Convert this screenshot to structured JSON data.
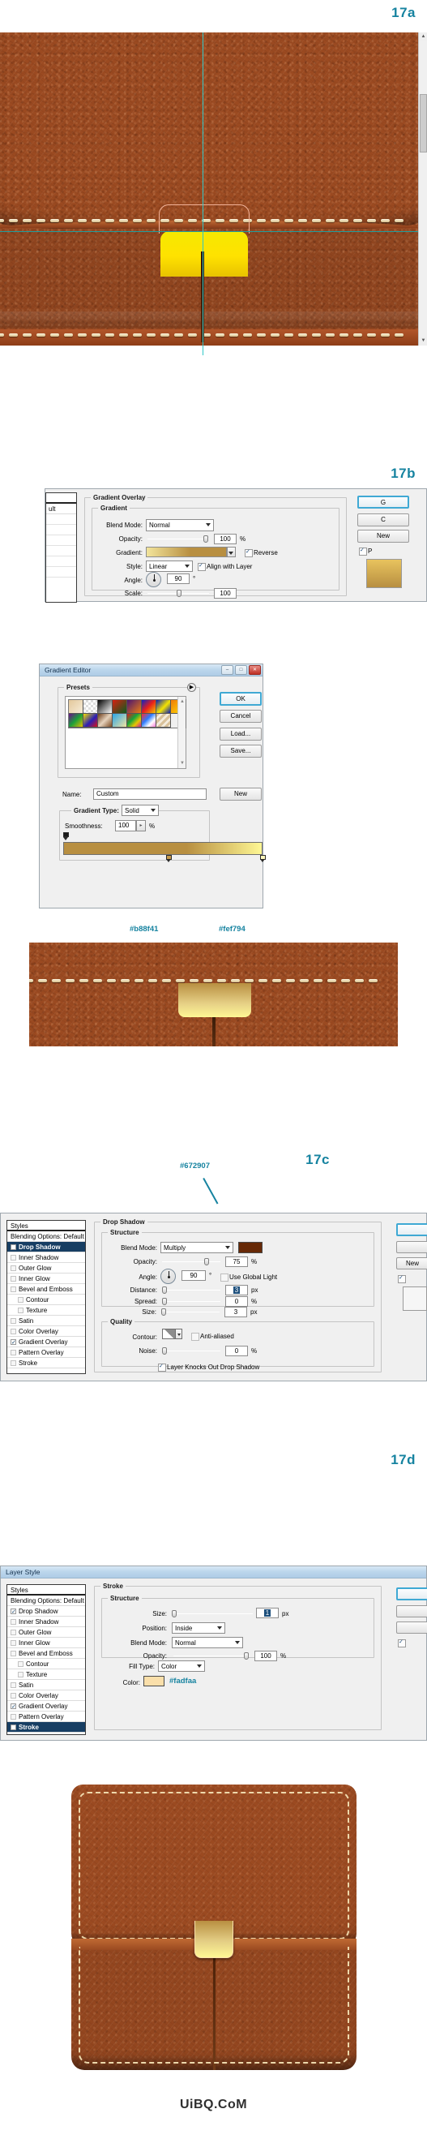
{
  "figures": {
    "a": "17a",
    "b": "17b",
    "c": "17c",
    "d": "17d"
  },
  "watermark": "UiBQ.CoM",
  "gradient_overlay": {
    "section_title": "Gradient Overlay",
    "subsection_title": "Gradient",
    "blend_mode_label": "Blend Mode:",
    "blend_mode_value": "Normal",
    "opacity_label": "Opacity:",
    "opacity_value": "100",
    "opacity_unit": "%",
    "gradient_label": "Gradient:",
    "reverse_label": "Reverse",
    "style_label": "Style:",
    "style_value": "Linear",
    "align_label": "Align with Layer",
    "angle_label": "Angle:",
    "angle_value": "90",
    "angle_unit": "°",
    "scale_label": "Scale:",
    "scale_value": "100",
    "left_panel_fragment": "ult",
    "right_buttons": {
      "ok_fragment": "G",
      "cancel_fragment": "C",
      "new_fragment": "New",
      "preview_fragment": "P"
    }
  },
  "gradient_editor": {
    "title": "Gradient Editor",
    "presets_label": "Presets",
    "name_label": "Name:",
    "name_value": "Custom",
    "gradient_type_label": "Gradient Type:",
    "gradient_type_value": "Solid",
    "smoothness_label": "Smoothness:",
    "smoothness_value": "100",
    "smoothness_unit": "%",
    "buttons": {
      "ok": "OK",
      "cancel": "Cancel",
      "load": "Load...",
      "save": "Save...",
      "new": "New"
    },
    "win_buttons": {
      "minimize": "–",
      "maximize": "□",
      "close": "✕"
    },
    "stop_colors": {
      "left": "#b88f41",
      "right": "#fef794"
    },
    "hex_left": "#b88f41",
    "hex_right": "#fef794"
  },
  "drop_shadow": {
    "panel_title": "Drop Shadow",
    "structure_title": "Structure",
    "quality_title": "Quality",
    "blend_mode_label": "Blend Mode:",
    "blend_mode_value": "Multiply",
    "opacity_label": "Opacity:",
    "opacity_value": "75",
    "opacity_unit": "%",
    "angle_label": "Angle:",
    "angle_value": "90",
    "angle_unit": "°",
    "use_global_light_label": "Use Global Light",
    "distance_label": "Distance:",
    "distance_value": "3",
    "distance_unit": "px",
    "spread_label": "Spread:",
    "spread_value": "0",
    "spread_unit": "%",
    "size_label": "Size:",
    "size_value": "3",
    "size_unit": "px",
    "contour_label": "Contour:",
    "anti_aliased_label": "Anti-aliased",
    "noise_label": "Noise:",
    "noise_value": "0",
    "noise_unit": "%",
    "knockout_label": "Layer Knocks Out Drop Shadow",
    "shadow_color_hex": "#672907",
    "hex_callout": "#672907"
  },
  "stroke": {
    "window_title": "Layer Style",
    "panel_title": "Stroke",
    "structure_title": "Structure",
    "size_label": "Size:",
    "size_value": "1",
    "size_unit": "px",
    "position_label": "Position:",
    "position_value": "Inside",
    "blend_mode_label": "Blend Mode:",
    "blend_mode_value": "Normal",
    "opacity_label": "Opacity:",
    "opacity_value": "100",
    "opacity_unit": "%",
    "fill_type_label": "Fill Type:",
    "fill_type_value": "Color",
    "color_label": "Color:",
    "color_hex": "#fadfaa",
    "hex_callout": "#fadfaa"
  },
  "styles_panel": {
    "header": "Styles",
    "blending_options": "Blending Options: Default",
    "items": [
      {
        "label": "Drop Shadow",
        "checked": true
      },
      {
        "label": "Inner Shadow",
        "checked": false
      },
      {
        "label": "Outer Glow",
        "checked": false
      },
      {
        "label": "Inner Glow",
        "checked": false
      },
      {
        "label": "Bevel and Emboss",
        "checked": false
      },
      {
        "label": "Contour",
        "checked": false,
        "indent": true
      },
      {
        "label": "Texture",
        "checked": false,
        "indent": true
      },
      {
        "label": "Satin",
        "checked": false
      },
      {
        "label": "Color Overlay",
        "checked": false
      },
      {
        "label": "Gradient Overlay",
        "checked": true
      },
      {
        "label": "Pattern Overlay",
        "checked": false
      },
      {
        "label": "Stroke",
        "checked": false
      }
    ],
    "active_index_c": 0,
    "active_index_d": 11
  },
  "colors": {
    "accent_teal": "#1683a0",
    "leather_brown": "#9b4a21",
    "clasp_yellow": "#ffe200",
    "guide_cyan": "#31c8c8",
    "selection_pink": "#f3b49a"
  }
}
